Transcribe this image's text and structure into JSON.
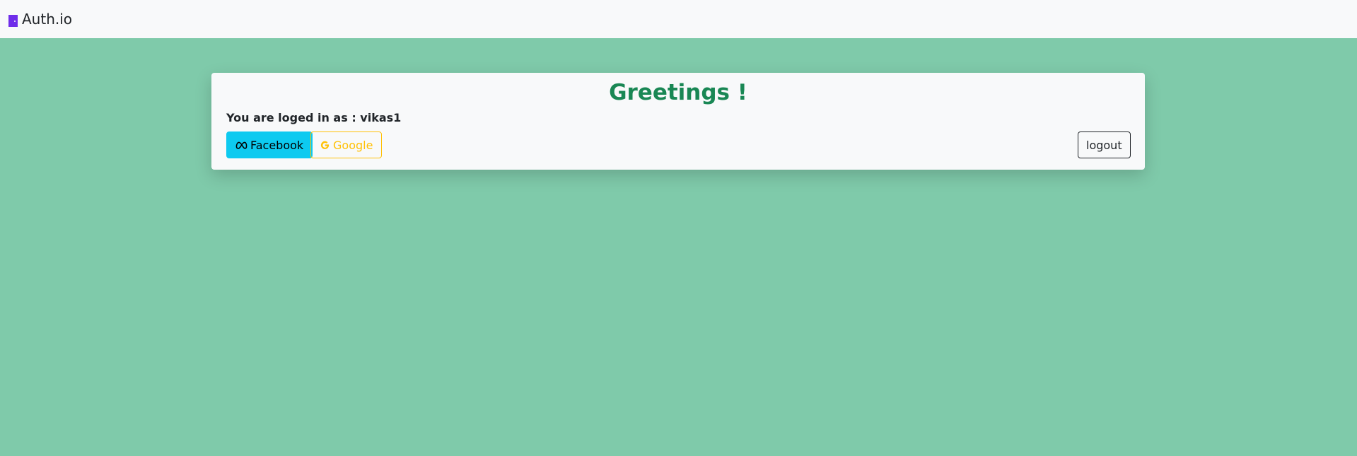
{
  "navbar": {
    "brand_label": "Auth.io",
    "brand_icon": "door-icon"
  },
  "card": {
    "title": "Greetings !",
    "logged_in_text": "You are loged in as : vikas1",
    "buttons": {
      "facebook_label": "Facebook",
      "facebook_icon": "meta-icon",
      "google_label": "Google",
      "google_icon": "google-icon",
      "logout_label": "logout"
    }
  },
  "colors": {
    "background": "#7fcaaa",
    "navbar": "#f8f9fa",
    "title": "#198754",
    "facebook_button": "#0dcaf0",
    "google_button": "#ffc107",
    "brand_icon": "#6f2dea"
  }
}
